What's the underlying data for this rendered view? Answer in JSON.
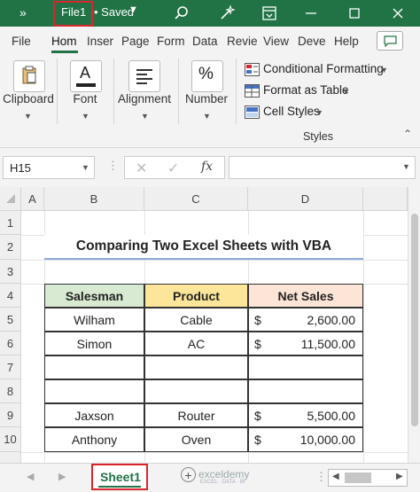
{
  "titlebar": {
    "quick_access": "»",
    "file_name": "File1",
    "status": "• Saved",
    "icons": [
      "search-icon",
      "magic-wand-icon",
      "ribbon-display-icon",
      "minimize-icon",
      "maximize-icon",
      "close-icon"
    ]
  },
  "tabs": [
    "File",
    "Hom",
    "Inser",
    "Page",
    "Form",
    "Data",
    "Revie",
    "View",
    "Deve",
    "Help"
  ],
  "active_tab": "Hom",
  "ribbon": {
    "clipboard_label": "Clipboard",
    "font_label": "Font",
    "alignment_label": "Alignment",
    "number_label": "Number",
    "number_glyph": "%",
    "conditional_formatting": "Conditional Formatting",
    "format_as_table": "Format as Table",
    "cell_styles": "Cell Styles",
    "styles_label": "Styles"
  },
  "formula_bar": {
    "name_box": "H15",
    "fx": "fx",
    "formula": ""
  },
  "sheet": {
    "columns": [
      "A",
      "B",
      "C",
      "D"
    ],
    "rows": [
      "1",
      "2",
      "3",
      "4",
      "5",
      "6",
      "7",
      "8",
      "9",
      "10"
    ],
    "title": "Comparing Two Excel Sheets with VBA",
    "headers": [
      "Salesman",
      "Product",
      "Net Sales"
    ],
    "header_colors": [
      "#d9ead3",
      "#fde699",
      "#fce4d6"
    ],
    "data": [
      {
        "salesman": "Wilham",
        "product": "Cable",
        "currency": "$",
        "sales": "2,600.00"
      },
      {
        "salesman": "Simon",
        "product": "AC",
        "currency": "$",
        "sales": "11,500.00"
      },
      {
        "salesman": "",
        "product": "",
        "currency": "",
        "sales": ""
      },
      {
        "salesman": "",
        "product": "",
        "currency": "",
        "sales": ""
      },
      {
        "salesman": "Jaxson",
        "product": "Router",
        "currency": "$",
        "sales": "5,500.00"
      },
      {
        "salesman": "Anthony",
        "product": "Oven",
        "currency": "$",
        "sales": "10,000.00"
      }
    ]
  },
  "bottom": {
    "sheet_tab": "Sheet1",
    "watermark": "exceldemy",
    "watermark_sub": "EXCEL · DATA · BI"
  },
  "colors": {
    "excel_green": "#217346",
    "highlight_red": "#d9262c",
    "title_underline": "#8eaadb"
  }
}
